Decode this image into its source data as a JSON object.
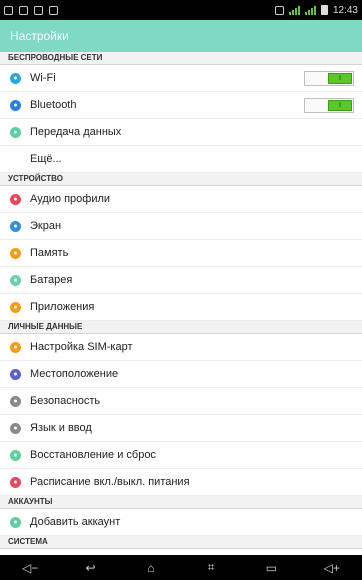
{
  "status_bar": {
    "time": "12:43"
  },
  "action_bar": {
    "title": "Настройки"
  },
  "sections": [
    {
      "header": "БЕСПРОВОДНЫЕ СЕТИ",
      "items": [
        {
          "label": "Wi-Fi",
          "icon": "wifi-icon",
          "color": "#29a8e0",
          "toggle": true,
          "toggle_label": "I"
        },
        {
          "label": "Bluetooth",
          "icon": "bluetooth-icon",
          "color": "#2b7de9",
          "toggle": true,
          "toggle_label": "I"
        },
        {
          "label": "Передача данных",
          "icon": "data-usage-icon",
          "color": "#5fcf9f"
        },
        {
          "label": "Ещё...",
          "icon": null
        }
      ]
    },
    {
      "header": "УСТРОЙСТВО",
      "items": [
        {
          "label": "Аудио профили",
          "icon": "audio-profiles-icon",
          "color": "#e8485c"
        },
        {
          "label": "Экран",
          "icon": "display-icon",
          "color": "#2f8fe0"
        },
        {
          "label": "Память",
          "icon": "storage-icon",
          "color": "#f59b16"
        },
        {
          "label": "Батарея",
          "icon": "battery-icon",
          "color": "#6cd1a7"
        },
        {
          "label": "Приложения",
          "icon": "apps-icon",
          "color": "#f59b16"
        }
      ]
    },
    {
      "header": "ЛИЧНЫЕ ДАННЫЕ",
      "items": [
        {
          "label": "Настройка SIM-карт",
          "icon": "sim-card-icon",
          "color": "#f59b16"
        },
        {
          "label": "Местоположение",
          "icon": "location-icon",
          "color": "#5b5fd1"
        },
        {
          "label": "Безопасность",
          "icon": "security-icon",
          "color": "#8a8a8a"
        },
        {
          "label": "Язык и ввод",
          "icon": "language-icon",
          "color": "#8a8a8a"
        },
        {
          "label": "Восстановление и сброс",
          "icon": "backup-reset-icon",
          "color": "#5fcf9f"
        },
        {
          "label": "Расписание вкл./выкл. питания",
          "icon": "power-schedule-icon",
          "color": "#e8485c"
        }
      ]
    },
    {
      "header": "АККАУНТЫ",
      "items": [
        {
          "label": "Добавить аккаунт",
          "icon": "add-account-icon",
          "color": "#5fcf9f"
        }
      ]
    },
    {
      "header": "СИСТЕМА",
      "items": []
    }
  ],
  "nav_bar": {
    "buttons": [
      {
        "name": "volume-down-icon",
        "glyph": "◁−"
      },
      {
        "name": "back-icon",
        "glyph": "↩"
      },
      {
        "name": "home-icon",
        "glyph": "⌂"
      },
      {
        "name": "screenshot-icon",
        "glyph": "⌗"
      },
      {
        "name": "recent-apps-icon",
        "glyph": "▭"
      },
      {
        "name": "volume-up-icon",
        "glyph": "◁+"
      }
    ]
  }
}
